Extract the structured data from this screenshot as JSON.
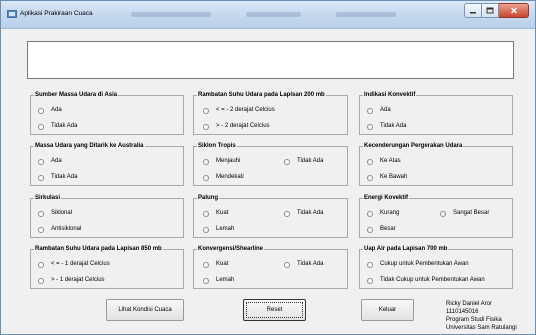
{
  "window": {
    "title": "Aplikasi Prakiraan Cuaca"
  },
  "display": {
    "value": ""
  },
  "groups": {
    "sumber": {
      "title": "Sumber Massa Udara di Asia",
      "options": [
        "Ada",
        "Tidak Ada"
      ]
    },
    "rambatan200": {
      "title": "Rambatan Suhu Udara pada Lapisan 200 mb",
      "options": [
        "< = - 2 derajat Celcius",
        ">   - 2 derajat Celcius"
      ]
    },
    "konvektif": {
      "title": "Indikasi Konvektif",
      "options": [
        "Ada",
        "Tidak Ada"
      ]
    },
    "massa": {
      "title": "Massa Udara yang Ditarik ke Australia",
      "options": [
        "Ada",
        "Tidak Ada"
      ]
    },
    "siklon": {
      "title": "Siklon Tropis",
      "options": [
        "Menjauhi",
        "Tidak Ada",
        "Mendekati"
      ]
    },
    "kecenderungan": {
      "title": "Kecenderungan Pergerakan Udara",
      "options": [
        "Ke Atas",
        "Ke Bawah"
      ]
    },
    "sirkulasi": {
      "title": "Sirkulasi",
      "options": [
        "Siklonal",
        "Antisiklonal"
      ]
    },
    "palung": {
      "title": "Palung",
      "options": [
        "Kuat",
        "Tidak Ada",
        "Lemah"
      ]
    },
    "energi": {
      "title": "Energi Kovektif",
      "options": [
        "Kurang",
        "Sangat Besar",
        "Besar"
      ]
    },
    "rambatan850": {
      "title": "Rambatan Suhu Udara pada Lapisan 850 mb",
      "options": [
        "< = - 1 derajat Celcius",
        ">   - 1 derajat Celcius"
      ]
    },
    "konvergensi": {
      "title": "Konvergensi/Shearline",
      "options": [
        "Kuat",
        "Tidak Ada",
        "Lemah"
      ]
    },
    "uap": {
      "title": "Uap Air pada Lapisan 700 mb",
      "options": [
        "Cukup untuk Pembentukan Awan",
        "Tidak Cukup untuk Pembentukan Awan"
      ]
    }
  },
  "buttons": {
    "lihat": "Lihat Kondisi Cuaca",
    "reset": "Reset",
    "keluar": "Keluar"
  },
  "credits": [
    "Ricky Daniel Aror",
    "1110145016",
    "Program Studi Fisika",
    "Universitas Sam Ratulangi"
  ]
}
